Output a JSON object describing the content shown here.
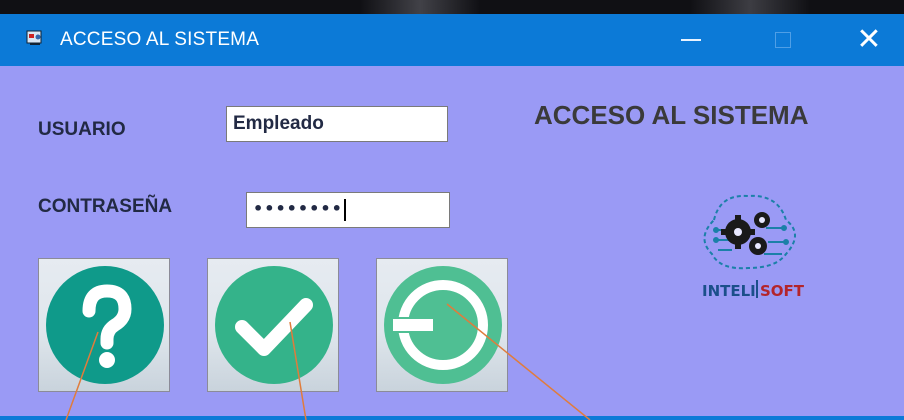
{
  "window": {
    "title": "ACCESO AL SISTEMA",
    "controls": [
      "minimize-icon",
      "maximize-icon",
      "close-icon"
    ],
    "close_glyph": "✕"
  },
  "form": {
    "username_label": "USUARIO",
    "username_value": "Empleado",
    "password_label": "CONTRASEÑA",
    "password_value": "••••••••",
    "heading": "ACCESO AL SISTEMA"
  },
  "buttons": [
    {
      "icon": "help-icon"
    },
    {
      "icon": "checkmark-icon"
    },
    {
      "icon": "exit-icon"
    }
  ],
  "logo": {
    "text_left": "INTELI",
    "text_right": "SOFT"
  },
  "colors": {
    "titlebar": "#0c7ad7",
    "background": "#9a9af5",
    "icon_teal": "#0f9a8a",
    "icon_green": "#34b38a",
    "icon_mint": "#4fbf93",
    "logo_red": "#b3252b",
    "annotation": "#e07c3c"
  }
}
